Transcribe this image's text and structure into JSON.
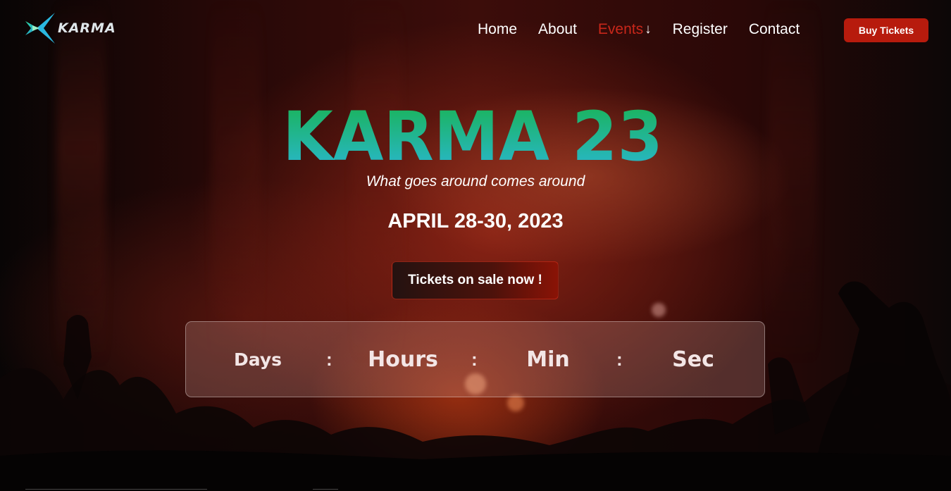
{
  "brand": {
    "logo_text": "KARMA"
  },
  "nav": {
    "items": [
      {
        "label": "Home",
        "active": false
      },
      {
        "label": "About",
        "active": false
      },
      {
        "label": "Events",
        "active": true
      },
      {
        "label": "Register",
        "active": false
      },
      {
        "label": "Contact",
        "active": false
      }
    ],
    "events_arrow": "↓",
    "buy_tickets_label": "Buy Tickets"
  },
  "hero": {
    "title": "KARMA 23",
    "tagline": "What goes around comes around",
    "date": "APRIL 28-30, 2023",
    "cta_label": "Tickets on sale now !"
  },
  "countdown": {
    "labels": [
      "Days",
      "Hours",
      "Min",
      "Sec"
    ],
    "separator": ":"
  },
  "colors": {
    "accent_red": "#b71b0d",
    "active_nav": "#c9271a",
    "title_gradient_top": "#19b34f",
    "title_gradient_bottom": "#2ab7d6"
  }
}
